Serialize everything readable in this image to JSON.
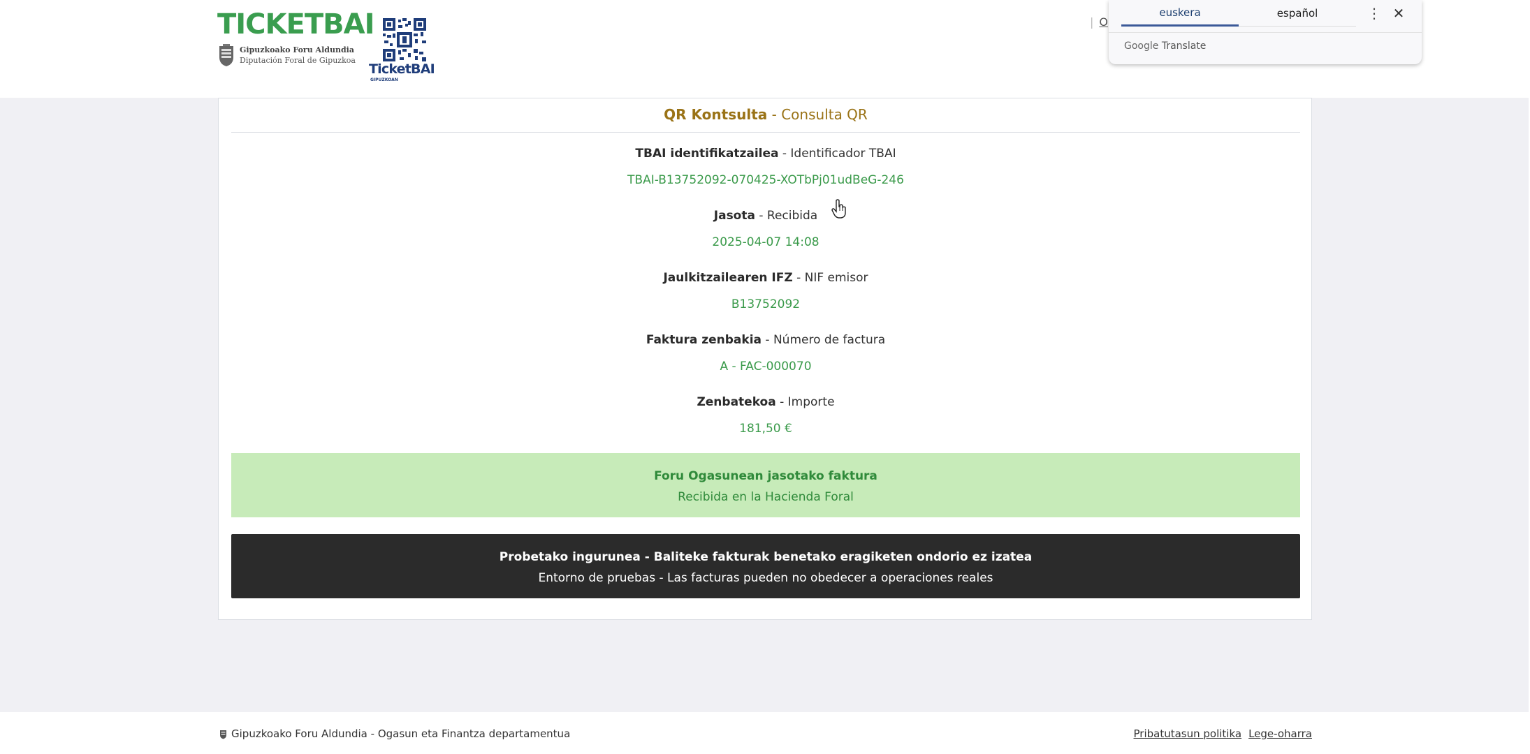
{
  "header": {
    "logo_wordmark": "TICKETBAI",
    "gipuzkoa_line1": "Gipuzkoako Foru Aldundia",
    "gipuzkoa_line2": "Diputación Foral de Gipuzkoa",
    "qr_label": "TicketBAI",
    "qr_sublabel": "GIPUZKOAN",
    "partial_link": "O"
  },
  "translate_popup": {
    "tab_active": "euskera",
    "tab_inactive": "español",
    "more_icon": "⋮",
    "close_icon": "✕",
    "brand_google": "Google",
    "brand_translate": "Translate"
  },
  "card": {
    "title_bold": "QR Kontsulta",
    "title_rest": " - Consulta QR",
    "fields": [
      {
        "label_bold": "TBAI identifikatzailea",
        "label_rest": " - Identificador TBAI",
        "value": "TBAI-B13752092-070425-XOTbPj01udBeG-246"
      },
      {
        "label_bold": "Jasota",
        "label_rest": " - Recibida",
        "value": "2025-04-07 14:08"
      },
      {
        "label_bold": "Jaulkitzailearen IFZ",
        "label_rest": " - NIF emisor",
        "value": "B13752092"
      },
      {
        "label_bold": "Faktura zenbakia",
        "label_rest": " - Número de factura",
        "value": "A - FAC-000070"
      },
      {
        "label_bold": "Zenbatekoa",
        "label_rest": " - Importe",
        "value": "181,50 €"
      }
    ],
    "status_green": {
      "line1": "Foru Ogasunean jasotako faktura",
      "line2": "Recibida en la Hacienda Foral"
    },
    "status_dark": {
      "line1": "Probetako ingurunea - Baliteke fakturak benetako eragiketen ondorio ez izatea",
      "line2": "Entorno de pruebas - Las facturas pueden no obedecer a operaciones reales"
    }
  },
  "footer": {
    "left_text": "Gipuzkoako Foru Aldundia - Ogasun eta Finantza departamentua",
    "link_privacy": "Pribatutasun politika",
    "link_legal": "Lege-oharra"
  },
  "colors": {
    "brand_green": "#3a9d4f",
    "title_gold": "#9a7317",
    "value_green": "#3a9a4a",
    "status_green_bg": "#c7ebb9",
    "status_dark_bg": "#2b2b2b",
    "qr_blue": "#1f3d7a"
  }
}
